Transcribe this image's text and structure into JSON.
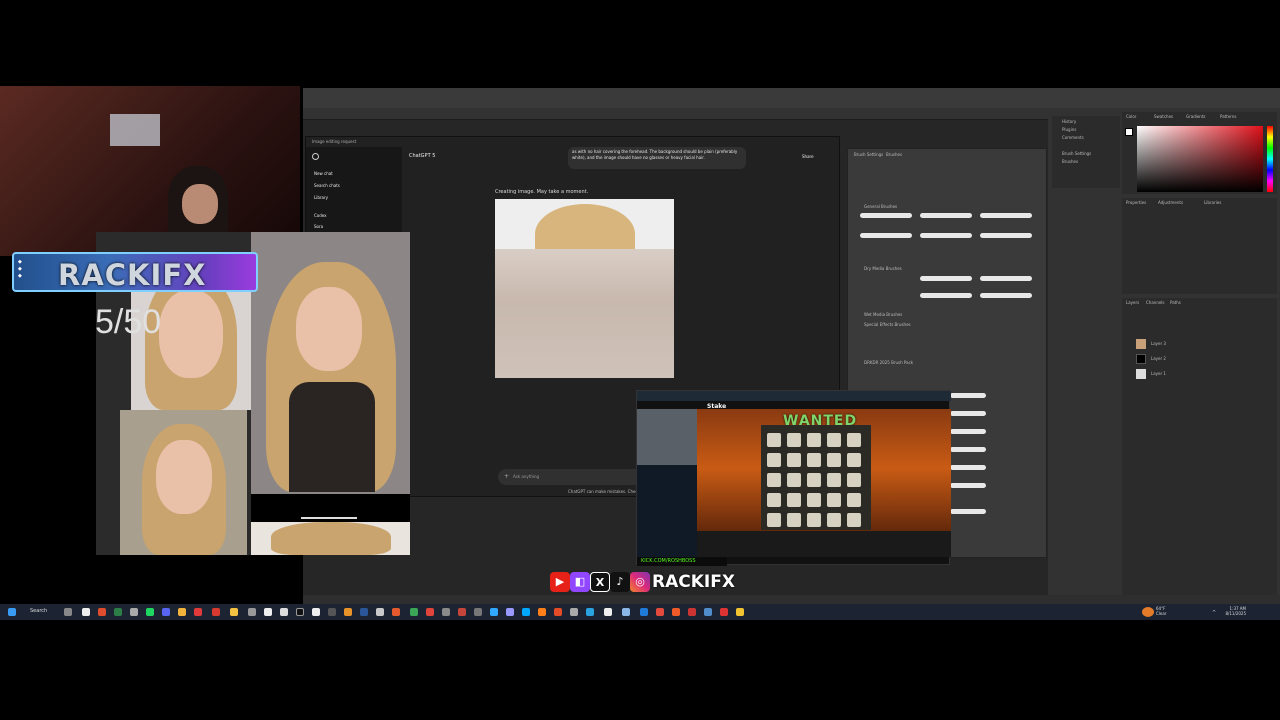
{
  "colors": {
    "brand_blue": "#3b6db8",
    "brand_purple": "#9b3be0",
    "taskbar": "#1c2433",
    "ps_bg": "#282828",
    "chat_bg": "#212121"
  },
  "photoshop": {
    "right_tabs": [
      "History",
      "Plugins",
      "Comments",
      "Brush Settings",
      "Brushes"
    ],
    "color_tabs": [
      "Color",
      "Swatches",
      "Gradients",
      "Patterns"
    ],
    "props_tabs": [
      "Properties",
      "Adjustments",
      "Libraries"
    ],
    "layers_tabs": [
      "Layers",
      "Channels",
      "Paths"
    ],
    "layers": [
      "Layer 3",
      "Layer 2",
      "Layer 1"
    ],
    "brush_panel_tabs": [
      "Brush Settings",
      "Brushes"
    ],
    "brush_groups": [
      "General Brushes",
      "Dry Media Brushes",
      "Wet Media Brushes",
      "Special Effects Brushes",
      "DRKDR 2025 Brush Pack"
    ]
  },
  "chatgpt": {
    "window_title": "Image editing request",
    "model": "ChatGPT 5",
    "share_label": "Share",
    "sidebar": [
      "New chat",
      "Search chats",
      "Library",
      "Codex",
      "Sora"
    ],
    "prompt_text": "as with no hair covering the forehead. The background should be plain (preferably white), and the image should have no glasses or heavy facial hair.",
    "status": "Creating image. May take a moment.",
    "input_placeholder": "Ask anything",
    "disclaimer": "ChatGPT can make mistakes. Check important info."
  },
  "overlay": {
    "brand": "RACKIFX",
    "counter": "5/50",
    "handle": "RACKIFX",
    "social_icons": [
      "youtube-icon",
      "twitch-icon",
      "x-icon",
      "tiktok-icon",
      "instagram-icon"
    ],
    "kick_url": "KICK.COM/ROSHBOSS"
  },
  "slot": {
    "site": "Stake",
    "game_title": "WANTED"
  },
  "taskbar": {
    "search": "Search",
    "weather_temp": "64°F",
    "weather_desc": "Clear",
    "time": "1:37 AM",
    "date": "8/11/2025"
  }
}
